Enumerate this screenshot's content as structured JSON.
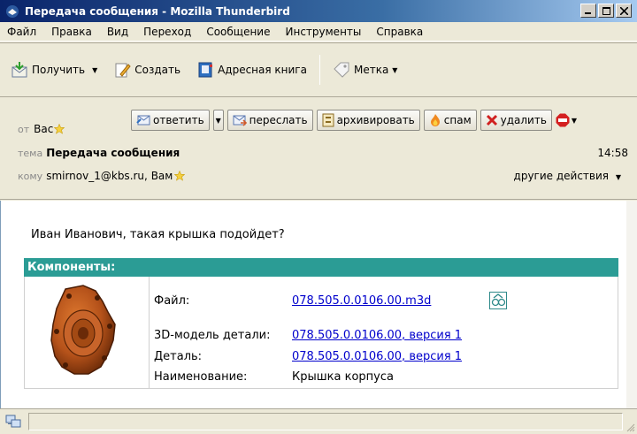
{
  "window": {
    "title": "Передача сообщения - Mozilla Thunderbird"
  },
  "menu": [
    "Файл",
    "Правка",
    "Вид",
    "Переход",
    "Сообщение",
    "Инструменты",
    "Справка"
  ],
  "toolbar": {
    "get_label": "Получить",
    "create_label": "Создать",
    "addressbook_label": "Адресная книга",
    "tag_label": "Метка"
  },
  "header": {
    "from_label": "от",
    "from_value": "Вас",
    "subject_label": "тема",
    "subject_value": "Передача сообщения",
    "time": "14:58",
    "to_label": "кому",
    "to_value": "smirnov_1@kbs.ru",
    "to_value2": "Вам",
    "other_actions": "другие действия",
    "reply_label": "ответить",
    "forward_label": "переслать",
    "archive_label": "архивировать",
    "spam_label": "спам",
    "delete_label": "удалить"
  },
  "body": {
    "text": "Иван Иванович, такая крышка подойдет?",
    "components_title": "Компоненты:",
    "rows": [
      {
        "label": "Файл:",
        "value": "078.505.0.0106.00.m3d"
      },
      {
        "label": "3D-модель детали:",
        "value": "078.505.0.0106.00, версия 1"
      },
      {
        "label": "Деталь:",
        "value": "078.505.0.0106.00, версия 1"
      },
      {
        "label": "Наименование:",
        "value": "Крышка корпуса"
      }
    ]
  },
  "colors": {
    "components_bar": "#2b9c95",
    "link": "#0000cc",
    "titlebar": "#0a246a",
    "part": "#b5521a"
  }
}
